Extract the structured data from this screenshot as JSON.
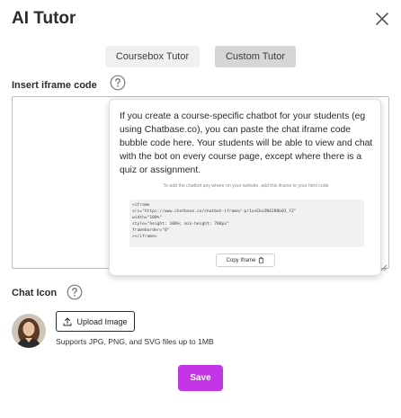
{
  "dialog": {
    "title": "AI Tutor",
    "close_icon": "close-icon"
  },
  "tabs": [
    {
      "label": "Coursebox Tutor",
      "active": false
    },
    {
      "label": "Custom Tutor",
      "active": true
    }
  ],
  "iframe_section": {
    "label": "Insert iframe code",
    "help_icon": "question-circle-icon",
    "value": ""
  },
  "tooltip": {
    "text": "If you create a course-specific chatbot for your students (eg using Chatbase.co), you can paste the chat iframe code bubble code here. Your students will be able to view and chat with the bot on every course page, except where there is a quiz or assignment.",
    "hint": "To add the chatbot any where on your website, add this iframe to your html code",
    "code_lines": [
      "<iframe",
      "src=\"https://www.chatbase.co/chatbot-iframe/-pr1xvEko2N4288b03_YZ\"",
      "width=\"100%\"",
      "style=\"height: 100%; min-height: 700px\"",
      "frameborder=\"0\"",
      "></iframe>"
    ],
    "copy_label": "Copy Iframe",
    "copy_icon": "clipboard-icon"
  },
  "chat_icon_section": {
    "label": "Chat Icon",
    "help_icon": "question-circle-icon",
    "upload_label": "Upload Image",
    "upload_icon": "upload-icon",
    "supports_text": "Supports JPG, PNG, and SVG files up to 1MB"
  },
  "save_label": "Save",
  "colors": {
    "accent": "#c234e6",
    "active_tab_bg": "#d6d6d6",
    "inactive_tab_bg": "#f0f0f0"
  }
}
